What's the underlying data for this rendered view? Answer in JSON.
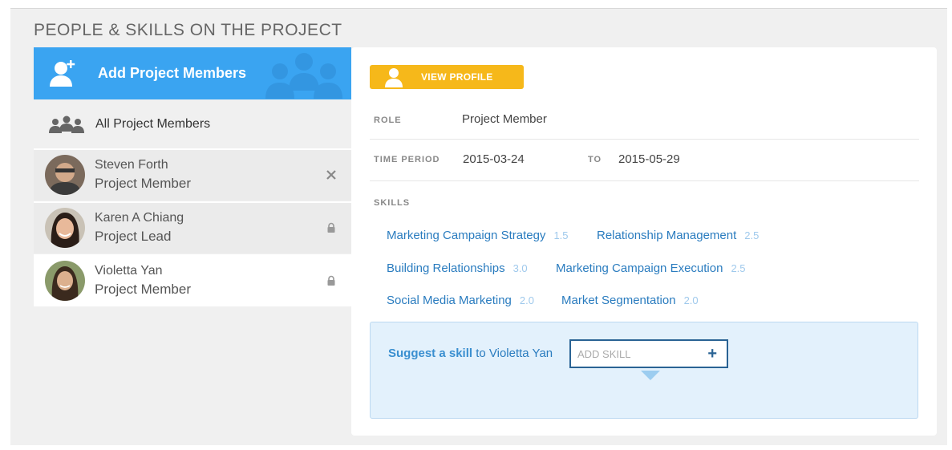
{
  "section_title": "PEOPLE & SKILLS ON THE PROJECT",
  "sidebar": {
    "add_members_label": "Add Project Members",
    "all_members_label": "All Project Members",
    "members": [
      {
        "name": "Steven Forth",
        "role": "Project Member",
        "action_icon": "close-icon"
      },
      {
        "name": "Karen A Chiang",
        "role": "Project Lead",
        "action_icon": "lock-icon"
      },
      {
        "name": "Violetta Yan",
        "role": "Project Member",
        "action_icon": "lock-icon",
        "selected": true
      }
    ]
  },
  "detail": {
    "view_profile_label": "VIEW PROFILE",
    "role_label": "ROLE",
    "role_value": "Project Member",
    "time_period_label": "TIME PERIOD",
    "start_date": "2015-03-24",
    "to_label": "TO",
    "end_date": "2015-05-29",
    "skills_label": "SKILLS",
    "skills": [
      {
        "name": "Marketing Campaign Strategy",
        "score": "1.5"
      },
      {
        "name": "Relationship Management",
        "score": "2.5"
      },
      {
        "name": "Building Relationships",
        "score": "3.0"
      },
      {
        "name": "Marketing Campaign Execution",
        "score": "2.5"
      },
      {
        "name": "Social Media Marketing",
        "score": "2.0"
      },
      {
        "name": "Market Segmentation",
        "score": "2.0"
      }
    ],
    "suggest": {
      "prefix": "Suggest a skill",
      "suffix": " to Violetta Yan",
      "placeholder": "ADD SKILL",
      "add_symbol": "+"
    }
  },
  "colors": {
    "accent_blue": "#3aa4f1",
    "link_blue": "#2a7cbf",
    "profile_yellow": "#f6b81a",
    "suggest_bg": "#e3f1fc"
  }
}
